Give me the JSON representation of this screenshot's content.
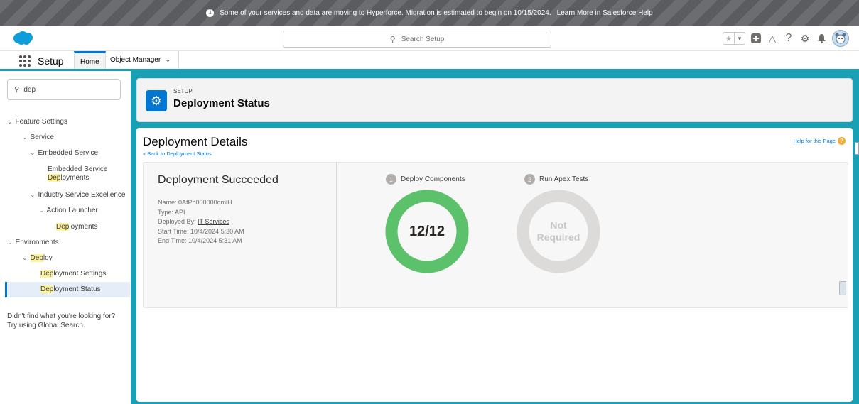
{
  "banner": {
    "message": "Some of your services and data are moving to Hyperforce. Migration is estimated to begin on 10/15/2024.",
    "link": "Learn More in Salesforce Help"
  },
  "header": {
    "search_placeholder": "Search Setup"
  },
  "appnav": {
    "app_name": "Setup",
    "tabs": [
      {
        "label": "Home",
        "active": true
      },
      {
        "label": "Object Manager",
        "active": false
      }
    ]
  },
  "sidebar": {
    "quick_find_value": "dep",
    "tree": [
      {
        "label": "Feature Settings"
      },
      {
        "label": "Service"
      },
      {
        "label": "Embedded Service"
      },
      {
        "label_plain": "Embedded Service",
        "label_hl": "Dep",
        "label_rest": "loyments"
      },
      {
        "label": "Industry Service Excellence"
      },
      {
        "label": "Action Launcher"
      },
      {
        "label_hl": "Dep",
        "label_rest": "loyments"
      },
      {
        "label": "Environments"
      },
      {
        "label_hl": "Dep",
        "label_rest": "loy"
      },
      {
        "label_hl": "Dep",
        "label_rest": "loyment Settings"
      },
      {
        "label_hl": "Dep",
        "label_rest": "loyment Status",
        "selected": true
      }
    ],
    "help_line1": "Didn't find what you're looking for?",
    "help_line2": "Try using Global Search."
  },
  "page_header": {
    "eyebrow": "SETUP",
    "title": "Deployment Status"
  },
  "details": {
    "title": "Deployment Details",
    "back_link": "« Back to Deployment Status",
    "help_link": "Help for this Page",
    "status_title": "Deployment Succeeded",
    "name_label": "Name:",
    "name_value": "0AfPh000000qmlH",
    "type_label": "Type:",
    "type_value": "API",
    "deployed_by_label": "Deployed By:",
    "deployed_by_value": "IT Services",
    "start_label": "Start Time:",
    "start_value": "10/4/2024 5:30 AM",
    "end_label": "End Time:",
    "end_value": "10/4/2024 5:31 AM",
    "steps": [
      {
        "number": "1",
        "label": "Deploy Components",
        "center_text": "12/12",
        "completed": 12,
        "total": 12,
        "color": "#5bc16a"
      },
      {
        "number": "2",
        "label": "Run Apex Tests",
        "center_line1": "Not",
        "center_line2": "Required",
        "color": "#dddbda"
      }
    ]
  },
  "colors": {
    "brand": "#0176d3",
    "teal_frame": "#1aa0b5",
    "success": "#5bc16a",
    "highlight": "#fef29a"
  },
  "icons": [
    "info-icon",
    "salesforce-cloud-logo",
    "search-icon",
    "favorites-star-icon",
    "chevron-down-icon",
    "global-actions-add-icon",
    "trailhead-icon",
    "help-icon",
    "setup-gear-icon",
    "notifications-bell-icon",
    "user-avatar",
    "app-launcher-icon",
    "gear-icon",
    "help-page-icon"
  ]
}
